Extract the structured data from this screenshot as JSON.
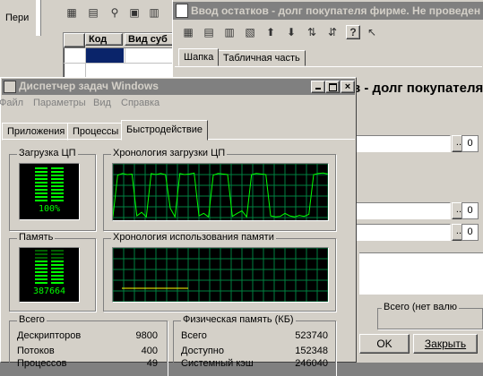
{
  "bg_window": {
    "left_label": "Пери",
    "table_headers": [
      "Код",
      "Вид суб"
    ]
  },
  "entry_window": {
    "title": "Ввод остатков - долг покупателя фирме. Не проведен",
    "tabs": [
      "Шапка",
      "Табличная часть"
    ],
    "heading": "в - долг покупателя",
    "field_zero": "0",
    "ellipsis": "...",
    "total_label": "Всего (нет валю",
    "ok_label": "OK",
    "close_label": "Закрыть"
  },
  "task_manager": {
    "title": "Диспетчер задач Windows",
    "menu": [
      "Файл",
      "Параметры",
      "Вид",
      "Справка"
    ],
    "tabs": [
      "Приложения",
      "Процессы",
      "Быстродействие"
    ],
    "cpu_label": "Загрузка ЦП",
    "cpu_value": "100%",
    "cpu_percent": 100,
    "cpu_history_label": "Хронология загрузки ЦП",
    "mem_label": "Память",
    "mem_value": "387664",
    "mem_history_label": "Хронология использования памяти",
    "totals": {
      "title": "Всего",
      "rows": [
        {
          "label": "Дескрипторов",
          "value": "9800"
        },
        {
          "label": "Потоков",
          "value": "400"
        },
        {
          "label": "Процессов",
          "value": "49"
        }
      ]
    },
    "physical": {
      "title": "Физическая память (КБ)",
      "rows": [
        {
          "label": "Всего",
          "value": "523740"
        },
        {
          "label": "Доступно",
          "value": "152348"
        },
        {
          "label": "Системный кэш",
          "value": "246040"
        }
      ]
    },
    "cpu_history": [
      0.03,
      0.85,
      0.88,
      0.86,
      0.87,
      0.05,
      0.12,
      0.03,
      0.88,
      0.86,
      0.88,
      0.86,
      0.2,
      0.03,
      0.88,
      0.86,
      0.87,
      0.89,
      0.05,
      0.1,
      0.03,
      0.85,
      0.88,
      0.87,
      0.86,
      0.04,
      0.1,
      0.15,
      0.03,
      0.86,
      0.88,
      0.87,
      0.86,
      0.05,
      0.03,
      0.04,
      0.1,
      0.05,
      0.03,
      0.06,
      0.04,
      0.08,
      0.86,
      0.88,
      0.89,
      0.87
    ],
    "mem_history_level": 0.25
  },
  "colors": {
    "face": "#d4d0c8",
    "titlebar": "#808080",
    "graph_green": "#00ff00",
    "grid_green": "#008040",
    "mem_line": "#ffff00",
    "selected_cell": "#0a246a"
  }
}
